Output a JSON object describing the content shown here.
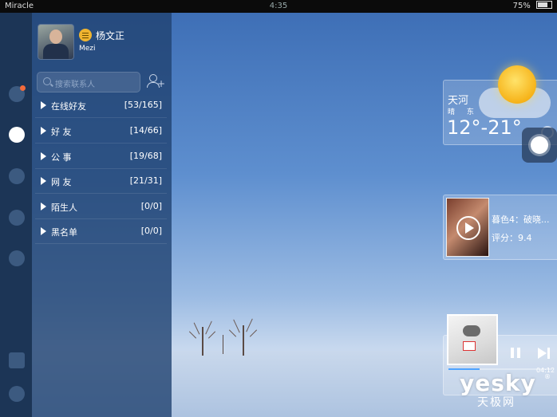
{
  "status_bar": {
    "carrier": "Miracle",
    "time": "4:35",
    "battery": "75%"
  },
  "profile": {
    "name": "杨文正",
    "signature": "Mezi"
  },
  "search": {
    "placeholder": "搜索联系人"
  },
  "groups": [
    {
      "name": "在线好友",
      "count": "[53/165]"
    },
    {
      "name": "好 友",
      "count": "[14/66]"
    },
    {
      "name": "公 事",
      "count": "[19/68]"
    },
    {
      "name": "网 友",
      "count": "[21/31]"
    },
    {
      "name": "陌生人",
      "count": "[0/0]"
    },
    {
      "name": "黑名单",
      "count": "[0/0]"
    }
  ],
  "sidebar_icons": [
    "recent-icon",
    "contacts-icon",
    "group-icon",
    "favorites-icon",
    "apps-icon",
    "skin-icon",
    "settings-icon"
  ],
  "weather": {
    "city": "天河",
    "desc": "晴 东",
    "temp": "12°-21°"
  },
  "movie": {
    "title": "暮色4：破晓...",
    "score": "评分：9.4"
  },
  "music": {
    "time": "04:12",
    "progress": 0.3
  },
  "watermark": {
    "brand": "yesky",
    "sub": "天极网",
    "reg": "®"
  },
  "colors": {
    "accent_blue": "#4fa3ff",
    "notification": "#f26a3b",
    "status_online": "#f0b430"
  }
}
